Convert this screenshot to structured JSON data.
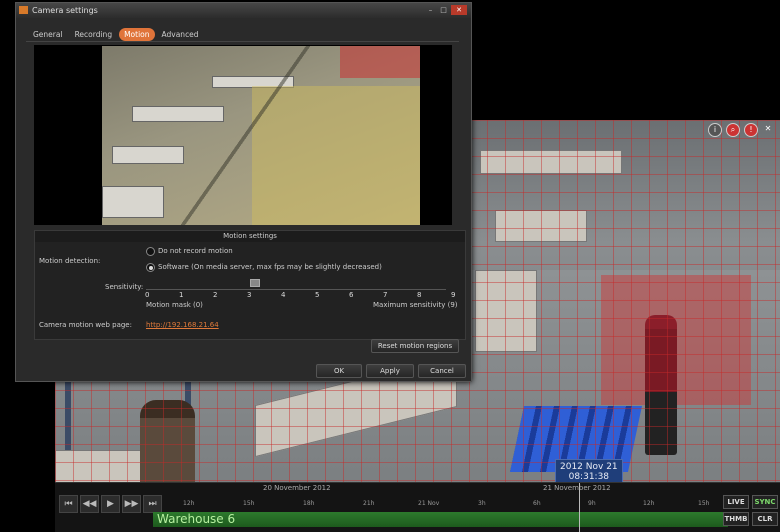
{
  "dialog": {
    "title": "Camera settings",
    "tabs": [
      "General",
      "Recording",
      "Motion",
      "Advanced"
    ],
    "active_tab": "Motion",
    "motion_settings": {
      "header": "Motion settings",
      "motion_detection_label": "Motion detection:",
      "option_none": "Do not record motion",
      "option_software": "Software (On media server, max fps may be slightly decreased)",
      "sensitivity_label": "Sensitivity:",
      "sensitivity_ticks": [
        "0",
        "1",
        "2",
        "3",
        "4",
        "5",
        "6",
        "7",
        "8",
        "9"
      ],
      "sensitivity_value": 3,
      "min_caption": "Motion mask (0)",
      "max_caption": "Maximum sensitivity (9)",
      "web_page_label": "Camera motion web page:",
      "web_page_link": "http://192.168.21.64"
    },
    "reset_label": "Reset motion regions",
    "ok_label": "OK",
    "apply_label": "Apply",
    "cancel_label": "Cancel"
  },
  "view": {
    "timestamp_date": "2012 Nov 21",
    "timestamp_time": "08:31:38"
  },
  "timeline": {
    "date_left": "20 November 2012",
    "date_right": "21 November 2012",
    "hours": [
      "12h",
      "15h",
      "18h",
      "21h",
      "21 Nov",
      "3h",
      "6h",
      "9h",
      "12h",
      "15h"
    ],
    "camera_label": "Warehouse 6",
    "buttons": {
      "live": "LIVE",
      "sync": "SYNC",
      "thumb": "THMB",
      "clear": "CLR"
    }
  },
  "colors": {
    "accent": "#e0743a",
    "timeline_green": "#2d7a2d"
  }
}
